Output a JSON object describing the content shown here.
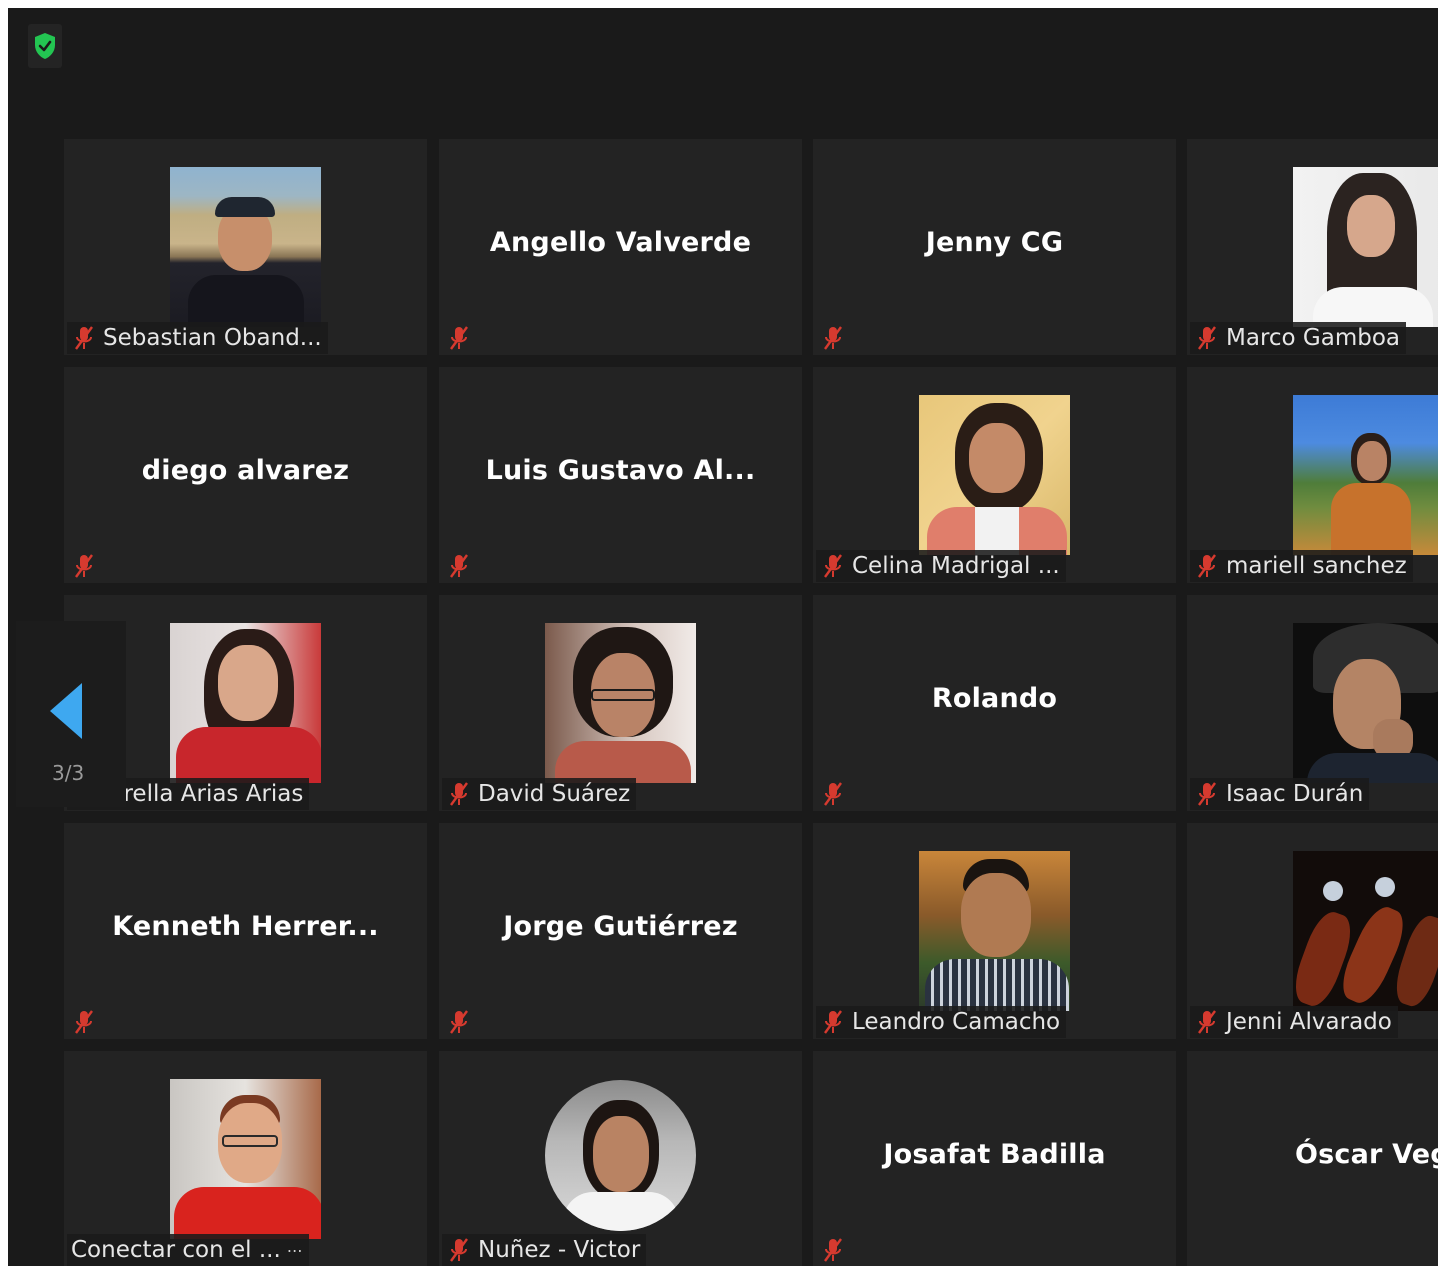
{
  "security_icon": "shield-check-icon",
  "accent_color": "#3ea8f0",
  "muted_color": "#d63a2f",
  "pagination": {
    "label": "3/3",
    "previous_icon": "triangle-left-icon"
  },
  "participants": [
    {
      "name": "Sebastian Oband...",
      "has_video": true,
      "muted": true
    },
    {
      "name": "Angello Valverde",
      "has_video": false,
      "muted": true
    },
    {
      "name": "Jenny CG",
      "has_video": false,
      "muted": true
    },
    {
      "name": "Marco Gamboa",
      "has_video": true,
      "muted": true
    },
    {
      "name": "diego alvarez",
      "has_video": false,
      "muted": true
    },
    {
      "name": "Luis Gustavo Al...",
      "has_video": false,
      "muted": true
    },
    {
      "name": "Celina Madrigal ...",
      "has_video": true,
      "muted": true
    },
    {
      "name": "mariell sanchez",
      "has_video": true,
      "muted": true
    },
    {
      "name": "iorella Arias Arias",
      "has_video": true,
      "muted": true
    },
    {
      "name": "David Suárez",
      "has_video": true,
      "muted": true
    },
    {
      "name": "Rolando",
      "has_video": false,
      "muted": true
    },
    {
      "name": "Isaac Durán",
      "has_video": true,
      "muted": true
    },
    {
      "name": "Kenneth  Herrer...",
      "has_video": false,
      "muted": true
    },
    {
      "name": "Jorge Gutiérrez",
      "has_video": false,
      "muted": true
    },
    {
      "name": "Leandro Camacho",
      "has_video": true,
      "muted": true
    },
    {
      "name": "Jenni Alvarado",
      "has_video": true,
      "muted": true
    },
    {
      "name": "Conectar con el ...",
      "has_video": true,
      "muted": false
    },
    {
      "name": "Nuñez - Victor",
      "has_video": true,
      "muted": true
    },
    {
      "name": "Josafat Badilla",
      "has_video": false,
      "muted": true
    },
    {
      "name": "Óscar Vega",
      "has_video": false,
      "muted": false
    }
  ]
}
